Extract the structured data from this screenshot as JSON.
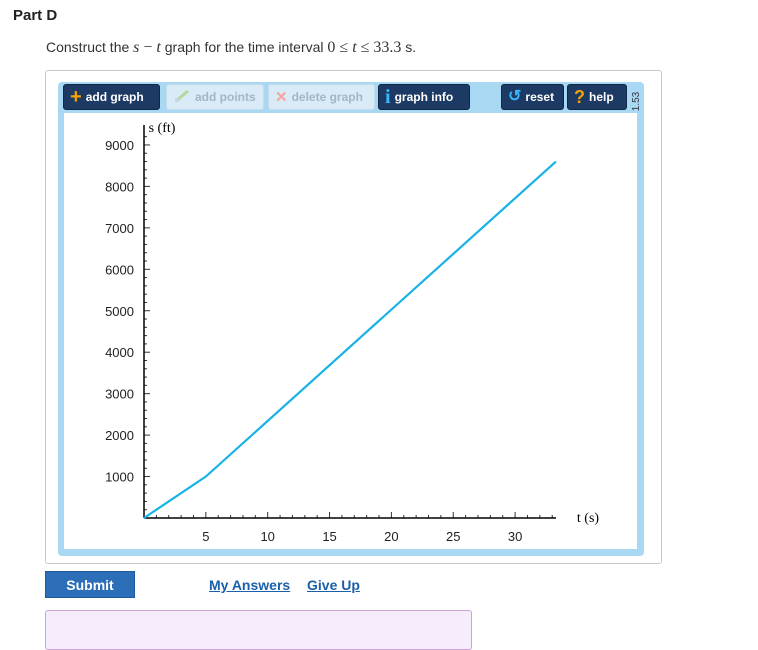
{
  "part": {
    "title": "Part D"
  },
  "prompt": {
    "text_before": "Construct the ",
    "s_var": "s",
    "dash": "−",
    "t_var": "t",
    "text_middle": " graph for the time interval ",
    "range_start": "0",
    "le1": "≤",
    "t_var2": "t",
    "le2": "≤",
    "range_end": "33.3",
    "range_unit": " s."
  },
  "toolbar": {
    "add_graph": {
      "label": "add graph",
      "icon": "plus-icon",
      "active": true
    },
    "add_points": {
      "label": "add points",
      "icon": "pencil-icon",
      "active": false
    },
    "delete_graph": {
      "label": "delete graph",
      "icon": "x-icon",
      "active": false
    },
    "graph_info": {
      "label": "graph info",
      "icon": "info-icon",
      "active": true
    },
    "reset": {
      "label": "reset",
      "icon": "reset-icon",
      "active": true
    },
    "help": {
      "label": "help",
      "icon": "question-icon",
      "active": true
    },
    "version": "1.53"
  },
  "chart_data": {
    "type": "line",
    "ylabel": "s (ft)",
    "xlabel": "t (s)",
    "x_ticks": [
      "5",
      "10",
      "15",
      "20",
      "25",
      "30"
    ],
    "y_ticks": [
      "1000",
      "2000",
      "3000",
      "4000",
      "5000",
      "6000",
      "7000",
      "8000",
      "9000"
    ],
    "xlim": [
      0,
      33.3
    ],
    "ylim": [
      0,
      9000
    ],
    "x_minor_step": 1,
    "y_minor_step": 200,
    "series": [
      {
        "points": [
          [
            0,
            0
          ],
          [
            5,
            1000
          ],
          [
            33.3,
            8600
          ]
        ],
        "color": "#19b2e6"
      }
    ]
  },
  "actions": {
    "submit": "Submit",
    "my_answers": "My Answers",
    "give_up": "Give Up"
  }
}
